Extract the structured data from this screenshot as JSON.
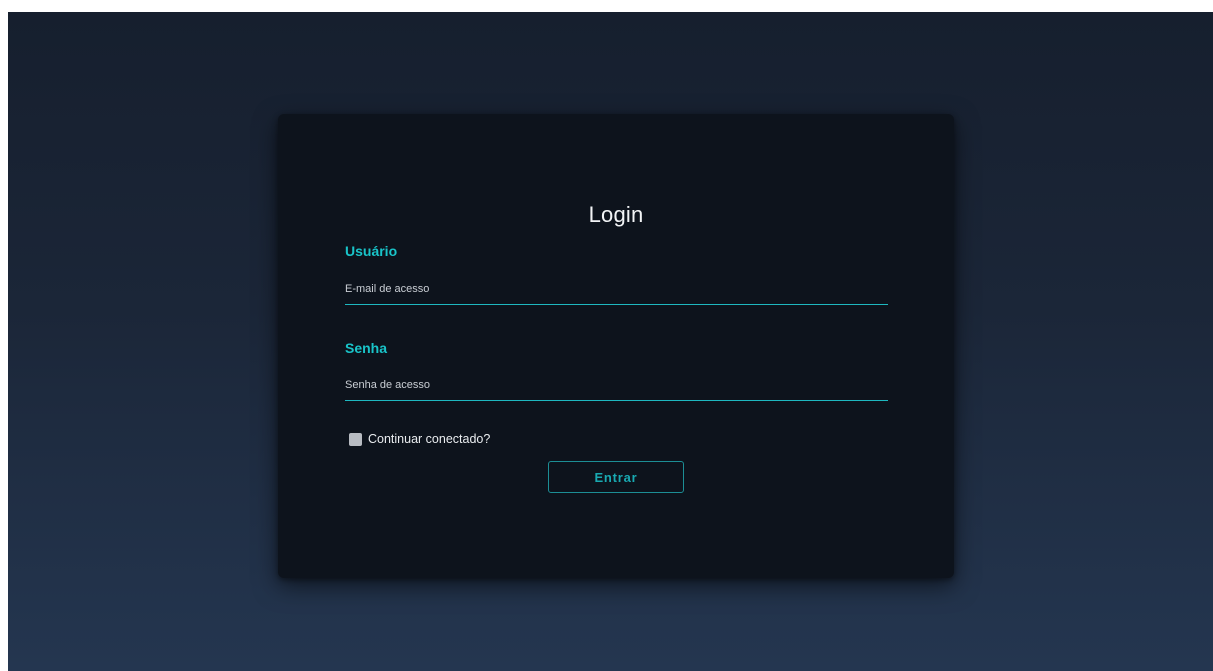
{
  "login": {
    "title": "Login",
    "username": {
      "label": "Usuário",
      "placeholder": "E-mail de acesso",
      "value": ""
    },
    "password": {
      "label": "Senha",
      "placeholder": "Senha de acesso",
      "value": ""
    },
    "remember_label": "Continuar conectado?",
    "remember_checked": false,
    "submit_label": "Entrar"
  },
  "colors": {
    "accent": "#19c4c9",
    "card_background": "#0d131c",
    "page_background": "#1b2638"
  }
}
